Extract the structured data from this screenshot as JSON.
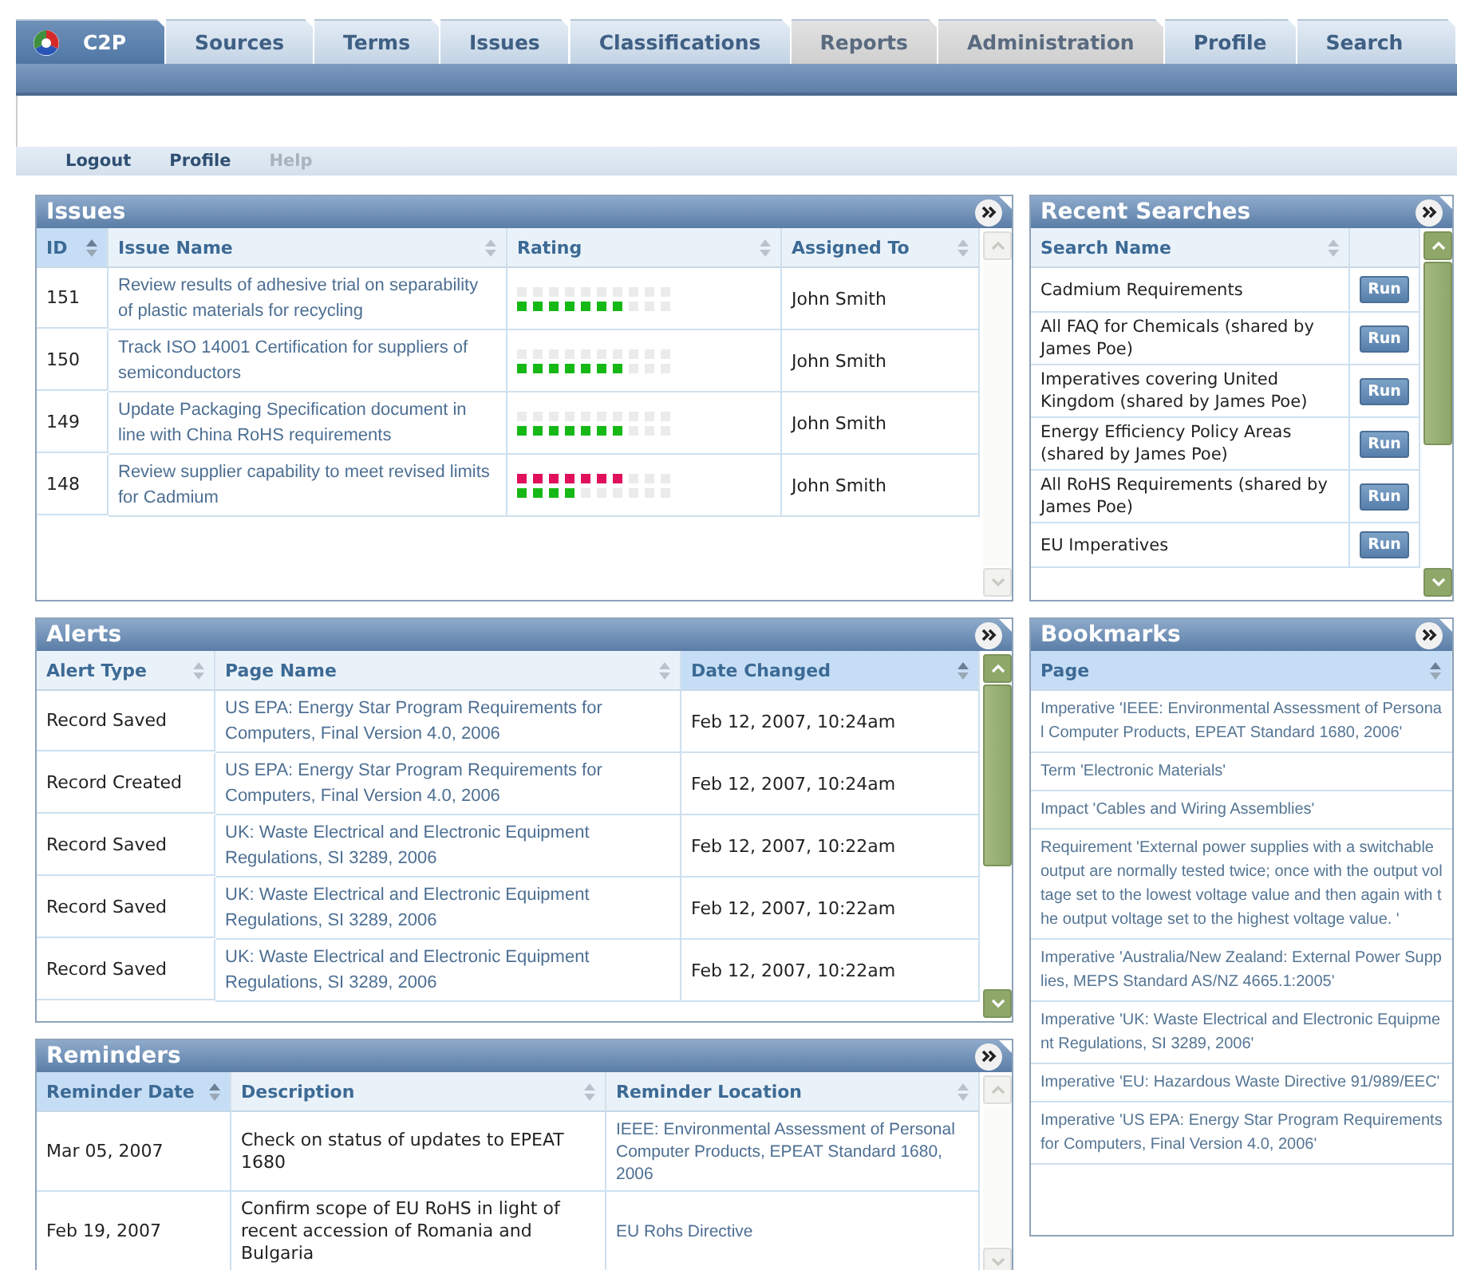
{
  "tabs": [
    {
      "label": "C2P",
      "selected": true,
      "disabled": false
    },
    {
      "label": "Sources",
      "selected": false,
      "disabled": false
    },
    {
      "label": "Terms",
      "selected": false,
      "disabled": false
    },
    {
      "label": "Issues",
      "selected": false,
      "disabled": false
    },
    {
      "label": "Classifications",
      "selected": false,
      "disabled": false
    },
    {
      "label": "Reports",
      "selected": false,
      "disabled": true
    },
    {
      "label": "Administration",
      "selected": false,
      "disabled": true
    },
    {
      "label": "Profile",
      "selected": false,
      "disabled": false
    },
    {
      "label": "Search",
      "selected": false,
      "disabled": false
    }
  ],
  "subnav": [
    {
      "label": "Logout",
      "disabled": false
    },
    {
      "label": "Profile",
      "disabled": false
    },
    {
      "label": "Help",
      "disabled": true
    }
  ],
  "issues": {
    "title": "Issues",
    "scrollbar": {
      "disabled": true
    },
    "columns": [
      {
        "label": "ID",
        "selected": true
      },
      {
        "label": "Issue Name",
        "selected": false
      },
      {
        "label": "Rating",
        "selected": false
      },
      {
        "label": "Assigned To",
        "selected": false
      }
    ],
    "rows": [
      {
        "id": "151",
        "name": "Review results of adhesive trial on separability of plastic materials for recycling",
        "rating": {
          "lower": {
            "color": "#16b816",
            "stars": 7
          }
        },
        "assigned_to": "John Smith"
      },
      {
        "id": "150",
        "name": "Track ISO 14001 Certification for suppliers of semiconductors",
        "rating": {
          "lower": {
            "color": "#16b816",
            "stars": 7
          }
        },
        "assigned_to": "John Smith"
      },
      {
        "id": "149",
        "name": "Update Packaging Specification document in line with China RoHS requirements",
        "rating": {
          "lower": {
            "color": "#16b816",
            "stars": 7
          }
        },
        "assigned_to": "John Smith"
      },
      {
        "id": "148",
        "name": "Review supplier capability to meet revised limits for Cadmium",
        "rating": {
          "upper": {
            "color": "#e0105c",
            "stars": 7
          },
          "lower": {
            "color": "#16b816",
            "stars": 4
          }
        },
        "assigned_to": "John Smith"
      }
    ]
  },
  "alerts": {
    "title": "Alerts",
    "scrollbar": {
      "disabled": false
    },
    "columns": [
      {
        "label": "Alert Type",
        "selected": false
      },
      {
        "label": "Page Name",
        "selected": false
      },
      {
        "label": "Date Changed",
        "selected": true
      }
    ],
    "rows": [
      {
        "type": "Record Saved",
        "page": "US EPA: Energy Star Program Requirements for Computers, Final Version 4.0, 2006",
        "date": "Feb 12, 2007, 10:24am"
      },
      {
        "type": "Record Created",
        "page": "US EPA: Energy Star Program Requirements for Computers, Final Version 4.0, 2006",
        "date": "Feb 12, 2007, 10:24am"
      },
      {
        "type": "Record Saved",
        "page": "UK: Waste Electrical and Electronic Equipment Regulations, SI 3289, 2006",
        "date": "Feb 12, 2007, 10:22am"
      },
      {
        "type": "Record Saved",
        "page": "UK: Waste Electrical and Electronic Equipment Regulations, SI 3289, 2006",
        "date": "Feb 12, 2007, 10:22am"
      },
      {
        "type": "Record Saved",
        "page": "UK: Waste Electrical and Electronic Equipment Regulations, SI 3289, 2006",
        "date": "Feb 12, 2007, 10:22am"
      }
    ]
  },
  "reminders": {
    "title": "Reminders",
    "scrollbar": {
      "disabled": true
    },
    "columns": [
      {
        "label": "Reminder Date",
        "selected": true
      },
      {
        "label": "Description",
        "selected": false
      },
      {
        "label": "Reminder Location",
        "selected": false
      }
    ],
    "rows": [
      {
        "date": "Mar 05, 2007",
        "description": "Check on status of updates to EPEAT 1680",
        "location": "IEEE: Environmental Assessment of Personal Computer Products, EPEAT Standard 1680, 2006"
      },
      {
        "date": "Feb 19, 2007",
        "description": "Confirm scope of EU RoHS in light of recent accession of Romania and Bulgaria",
        "location": "EU Rohs Directive"
      }
    ]
  },
  "recent_searches": {
    "title": "Recent Searches",
    "scrollbar": {
      "disabled": false
    },
    "columns": [
      {
        "label": "Search Name",
        "selected": false
      }
    ],
    "rows": [
      {
        "name": "Cadmium Requirements",
        "action": "Run"
      },
      {
        "name": "All FAQ for Chemicals (shared by James Poe)",
        "action": "Run"
      },
      {
        "name": "Imperatives covering United Kingdom (shared by James Poe)",
        "action": "Run"
      },
      {
        "name": "Energy Efficiency Policy Areas (shared by James Poe)",
        "action": "Run"
      },
      {
        "name": "All RoHS Requirements (shared by James Poe)",
        "action": "Run"
      },
      {
        "name": "EU Imperatives",
        "action": "Run"
      }
    ]
  },
  "bookmarks": {
    "title": "Bookmarks",
    "columns": [
      {
        "label": "Page",
        "selected": true
      }
    ],
    "rows": [
      "Imperative 'IEEE: Environmental Assessment of Personal Computer Products, EPEAT Standard 1680, 2006'",
      "Term 'Electronic Materials'",
      "Impact 'Cables and Wiring Assemblies'",
      "Requirement 'External power supplies with a switchable output are normally tested twice; once with the output voltage set to the lowest voltage value and then again with the output voltage set to the highest voltage value. '",
      "Imperative 'Australia/New Zealand: External Power Supplies, MEPS Standard AS/NZ 4665.1:2005'",
      "Imperative 'UK: Waste Electrical and Electronic Equipment Regulations, SI 3289, 2006'",
      "Imperative 'EU: Hazardous Waste Directive 91/989/EEC'",
      "Imperative 'US EPA: Energy Star Program Requirements for Computers, Final Version 4.0, 2006'"
    ]
  }
}
